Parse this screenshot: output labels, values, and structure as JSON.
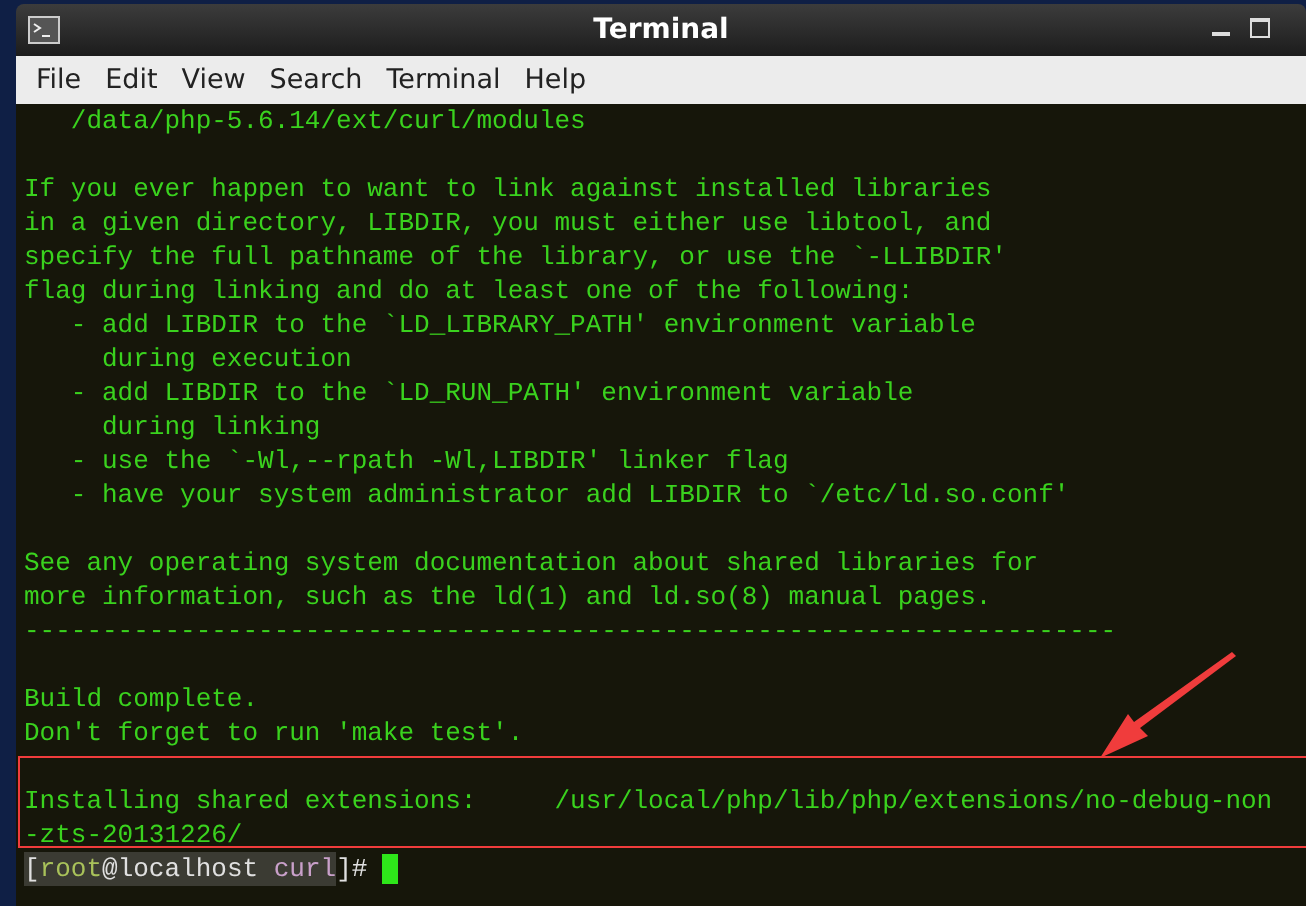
{
  "window": {
    "title": "Terminal"
  },
  "menu": [
    "File",
    "Edit",
    "View",
    "Search",
    "Terminal",
    "Help"
  ],
  "terminal": {
    "lines": [
      {
        "kind": "text",
        "text": "   /data/php-5.6.14/ext/curl/modules"
      },
      {
        "kind": "blank"
      },
      {
        "kind": "text",
        "text": "If you ever happen to want to link against installed libraries"
      },
      {
        "kind": "text",
        "text": "in a given directory, LIBDIR, you must either use libtool, and"
      },
      {
        "kind": "text",
        "text": "specify the full pathname of the library, or use the `-LLIBDIR'"
      },
      {
        "kind": "text",
        "text": "flag during linking and do at least one of the following:"
      },
      {
        "kind": "text",
        "text": "   - add LIBDIR to the `LD_LIBRARY_PATH' environment variable"
      },
      {
        "kind": "text",
        "text": "     during execution"
      },
      {
        "kind": "text",
        "text": "   - add LIBDIR to the `LD_RUN_PATH' environment variable"
      },
      {
        "kind": "text",
        "text": "     during linking"
      },
      {
        "kind": "text",
        "text": "   - use the `-Wl,--rpath -Wl,LIBDIR' linker flag"
      },
      {
        "kind": "text",
        "text": "   - have your system administrator add LIBDIR to `/etc/ld.so.conf'"
      },
      {
        "kind": "blank"
      },
      {
        "kind": "text",
        "text": "See any operating system documentation about shared libraries for"
      },
      {
        "kind": "text",
        "text": "more information, such as the ld(1) and ld.so(8) manual pages."
      },
      {
        "kind": "text",
        "text": "----------------------------------------------------------------------"
      },
      {
        "kind": "blank"
      },
      {
        "kind": "text",
        "text": "Build complete."
      },
      {
        "kind": "text",
        "text": "Don't forget to run 'make test'."
      },
      {
        "kind": "blank"
      },
      {
        "kind": "text",
        "text": "Installing shared extensions:     /usr/local/php/lib/php/extensions/no-debug-non"
      },
      {
        "kind": "text",
        "text": "-zts-20131226/"
      }
    ],
    "prompt": {
      "open": "[",
      "user": "root",
      "host": "@localhost",
      "dir": " curl",
      "close": "]#"
    }
  },
  "markup": {
    "highlight_box": true,
    "arrow": true
  }
}
